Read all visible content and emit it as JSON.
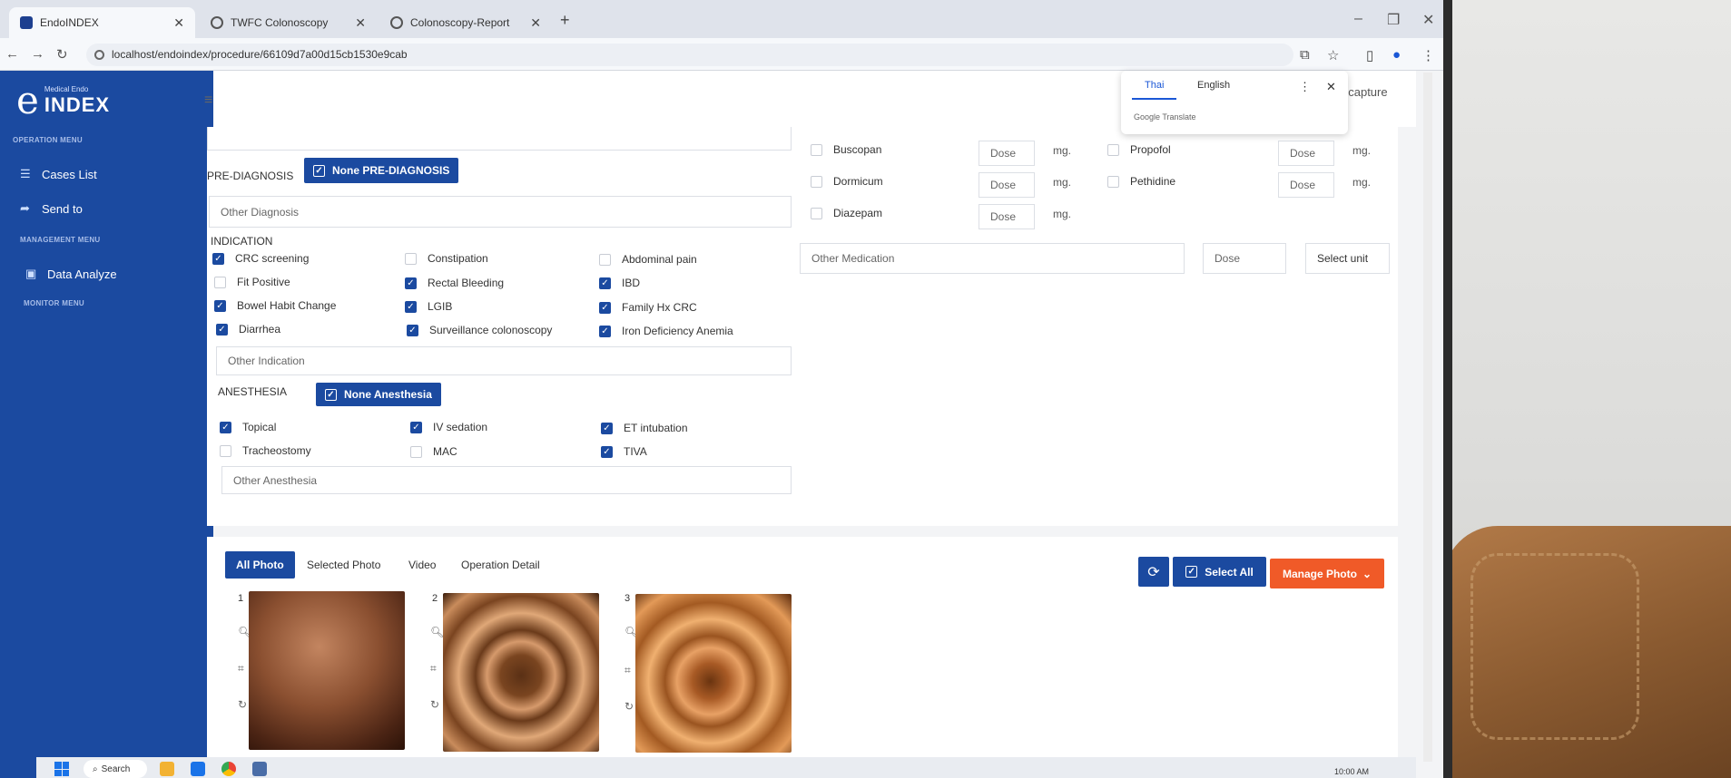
{
  "browser": {
    "tabs": [
      {
        "label": "EndoINDEX"
      },
      {
        "label": "TWFC Colonoscopy"
      },
      {
        "label": "Colonoscopy-Report"
      }
    ],
    "url": "localhost/endoindex/procedure/66109d7a00d15cb1530e9cab"
  },
  "translate": {
    "lang1": "Thai",
    "lang2": "English",
    "brand": "Google Translate"
  },
  "sidebar": {
    "logo_small": "Medical Endo",
    "logo_big": "INDEX",
    "operation_menu": "OPERATION MENU",
    "items_operation": [
      {
        "label": "Cases List"
      },
      {
        "label": "Send to"
      }
    ],
    "management_menu": "MANAGEMENT MENU",
    "items_management": [
      {
        "label": "Data Analyze"
      }
    ],
    "monitor_menu": "MONITOR MENU"
  },
  "header": {
    "capture_text": "ocapture"
  },
  "prediagnosis": {
    "label": "PRE-DIAGNOSIS",
    "none_button": "None PRE-DIAGNOSIS",
    "other_placeholder": "Other Diagnosis"
  },
  "indication": {
    "label": "INDICATION",
    "options": [
      {
        "label": "CRC screening",
        "checked": true
      },
      {
        "label": "Constipation",
        "checked": false
      },
      {
        "label": "Abdominal pain",
        "checked": false
      },
      {
        "label": "Fit Positive",
        "checked": false
      },
      {
        "label": "Rectal Bleeding",
        "checked": true
      },
      {
        "label": "IBD",
        "checked": true
      },
      {
        "label": "Bowel Habit Change",
        "checked": true
      },
      {
        "label": "LGIB",
        "checked": true
      },
      {
        "label": "Family Hx CRC",
        "checked": true
      },
      {
        "label": "Diarrhea",
        "checked": true
      },
      {
        "label": "Surveillance colonoscopy",
        "checked": true
      },
      {
        "label": "Iron Deficiency Anemia",
        "checked": true
      }
    ],
    "other_placeholder": "Other Indication"
  },
  "anesthesia": {
    "label": "ANESTHESIA",
    "none_button": "None Anesthesia",
    "options": [
      {
        "label": "Topical",
        "checked": true
      },
      {
        "label": "IV sedation",
        "checked": true
      },
      {
        "label": "ET intubation",
        "checked": true
      },
      {
        "label": "Tracheostomy",
        "checked": false
      },
      {
        "label": "MAC",
        "checked": false
      },
      {
        "label": "TIVA",
        "checked": true
      }
    ],
    "other_placeholder": "Other Anesthesia"
  },
  "medication": {
    "left": [
      {
        "name": "Buscopan",
        "dose": "Dose",
        "unit": "mg."
      },
      {
        "name": "Dormicum",
        "dose": "Dose",
        "unit": "mg."
      },
      {
        "name": "Diazepam",
        "dose": "Dose",
        "unit": "mg."
      }
    ],
    "right": [
      {
        "name": "Propofol",
        "dose": "Dose",
        "unit": "mg."
      },
      {
        "name": "Pethidine",
        "dose": "Dose",
        "unit": "mg."
      }
    ],
    "other_placeholder": "Other Medication",
    "other_dose": "Dose",
    "select_unit": "Select unit"
  },
  "photos": {
    "tabs": [
      "All Photo",
      "Selected Photo",
      "Video",
      "Operation Detail"
    ],
    "select_all": "Select All",
    "manage": "Manage Photo",
    "items": [
      {
        "num": "1"
      },
      {
        "num": "2"
      },
      {
        "num": "3"
      }
    ]
  },
  "taskbar": {
    "search": "Search",
    "time": "10:00 AM"
  },
  "colors": {
    "primary": "#1b4aa0",
    "accent": "#f05a28"
  }
}
